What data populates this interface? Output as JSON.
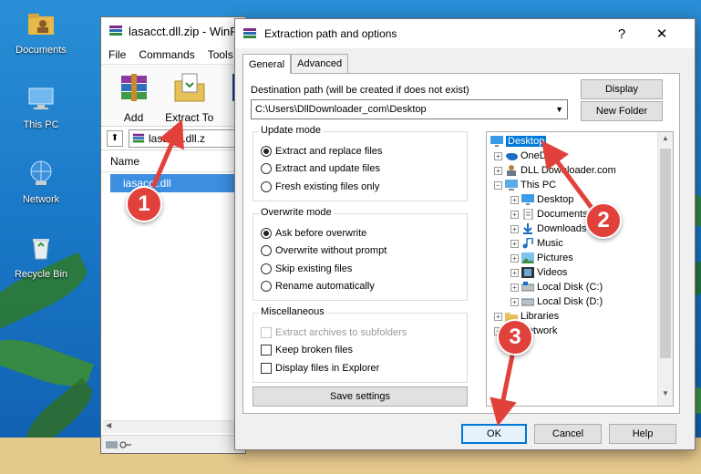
{
  "desktop": {
    "icons": [
      {
        "label": "Documents",
        "icon": "folder-user-icon"
      },
      {
        "label": "This PC",
        "icon": "computer-icon"
      },
      {
        "label": "Network",
        "icon": "network-icon"
      },
      {
        "label": "Recycle Bin",
        "icon": "recycle-bin-icon"
      }
    ]
  },
  "winrar": {
    "title": "lasacct.dll.zip - WinR",
    "menu": [
      "File",
      "Commands",
      "Tools"
    ],
    "toolbar": [
      "Add",
      "Extract To"
    ],
    "address": "lasacct.dll.z",
    "column_name": "Name",
    "file": "iasacct.dll"
  },
  "dialog": {
    "title": "Extraction path and options",
    "help_glyph": "?",
    "close_glyph": "✕",
    "tabs": [
      "General",
      "Advanced"
    ],
    "dest_label": "Destination path (will be created if does not exist)",
    "dest_value": "C:\\Users\\DllDownloader_com\\Desktop",
    "display_btn": "Display",
    "new_folder_btn": "New Folder",
    "update_mode": {
      "title": "Update mode",
      "options": [
        "Extract and replace files",
        "Extract and update files",
        "Fresh existing files only"
      ],
      "selected": 0
    },
    "overwrite_mode": {
      "title": "Overwrite mode",
      "options": [
        "Ask before overwrite",
        "Overwrite without prompt",
        "Skip existing files",
        "Rename automatically"
      ],
      "selected": 0
    },
    "misc": {
      "title": "Miscellaneous",
      "options": [
        "Extract archives to subfolders",
        "Keep broken files",
        "Display files in Explorer"
      ]
    },
    "save_btn": "Save settings",
    "tree": [
      {
        "label": "Desktop",
        "icon": "desktop-icon",
        "selected": true
      },
      {
        "label": "OneDrive",
        "icon": "onedrive-icon"
      },
      {
        "label": "DLL Downloader.com",
        "icon": "user-icon"
      },
      {
        "label": "This PC",
        "icon": "computer-icon"
      },
      {
        "label": "Desktop",
        "icon": "desktop-icon"
      },
      {
        "label": "Documents",
        "icon": "documents-icon"
      },
      {
        "label": "Downloads",
        "icon": "download-icon"
      },
      {
        "label": "Music",
        "icon": "music-icon"
      },
      {
        "label": "Pictures",
        "icon": "pictures-icon"
      },
      {
        "label": "Videos",
        "icon": "videos-icon"
      },
      {
        "label": "Local Disk (C:)",
        "icon": "disk-icon"
      },
      {
        "label": "Local Disk (D:)",
        "icon": "disk-icon"
      },
      {
        "label": "Libraries",
        "icon": "folder-icon"
      },
      {
        "label": "Network",
        "icon": "network-icon"
      }
    ],
    "ok_btn": "OK",
    "cancel_btn": "Cancel",
    "help_btn": "Help"
  },
  "callouts": [
    "1",
    "2",
    "3"
  ],
  "colors": {
    "accent": "#0078d7",
    "callout": "#e1413b",
    "selection": "#3d8ee0"
  }
}
